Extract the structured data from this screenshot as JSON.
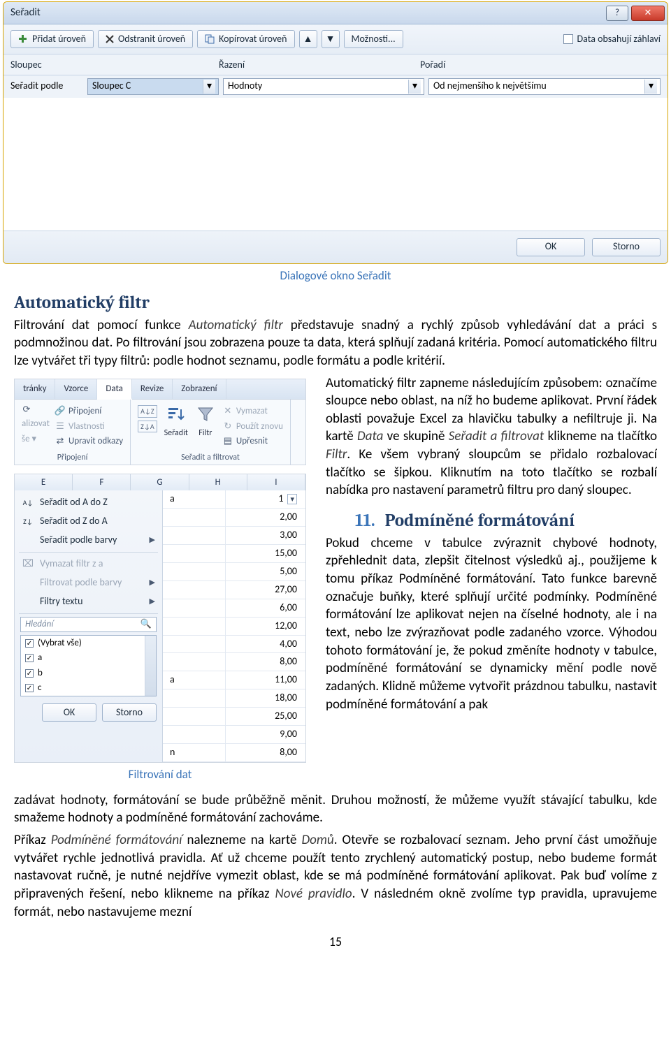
{
  "dialog": {
    "title": "Seřadit",
    "toolbar": {
      "add": "Přidat úroveň",
      "remove": "Odstranit úroveň",
      "copy": "Kopírovat úroveň",
      "options": "Možnosti...",
      "headers": "Data obsahují záhlaví"
    },
    "headers": {
      "col1": "Sloupec",
      "col2": "Řazení",
      "col3": "Pořadí"
    },
    "row": {
      "label": "Seřadit podle",
      "col": "Sloupec C",
      "by": "Hodnoty",
      "order": "Od nejmenšího k největšímu"
    },
    "ok": "OK",
    "cancel": "Storno"
  },
  "caption1": "Dialogové okno Seřadit",
  "sec_autofilter": {
    "title": "Automatický filtr",
    "p1a": "Filtrování dat pomocí funkce ",
    "p1i": "Automatický filtr",
    "p1b": " představuje snadný a rychlý způsob vyhledávání dat a práci s podmnožinou dat. Po filtrování jsou zobrazena pouze ta data, která splňují zadaná kritéria. Pomocí automatického filtru lze vytvářet tři typy filtrů: podle hodnot seznamu, podle formátu a podle kritérií.",
    "p2a": "Automatický filtr zapneme následujícím způsobem: označíme sloupce nebo oblast, na níž ho budeme aplikovat. První řádek oblasti považuje Excel za hlavičku tabulky a nefiltruje ji. Na kartě ",
    "p2i1": "Data",
    "p2b": " ve skupině ",
    "p2i2": "Seřadit a filtrovat",
    "p2c": " klikneme na tlačítko ",
    "p2i3": "Filtr",
    "p2d": ". Ke všem vybraný sloupcům se přidalo rozbalovací tlačítko se šipkou. Kliknutím na toto tlačítko se rozbalí nabídka pro nastavení parametrů filtru pro daný sloupec."
  },
  "ribbon": {
    "tabs": [
      "tránky",
      "Vzorce",
      "Data",
      "Revize",
      "Zobrazení"
    ],
    "grp1_items": [
      "Připojení",
      "Vlastnosti",
      "Upravit odkazy"
    ],
    "grp1_left": "alizovat",
    "grp1_left2": "še ▾",
    "grp1_title": "Připojení",
    "grp2_sort_az": "A→Z",
    "grp2_sort_za": "Z→A",
    "grp2_sort": "Seřadit",
    "grp2_filter": "Filtr",
    "grp2_items": [
      "Vymazat",
      "Použít znovu",
      "Upřesnit"
    ],
    "grp2_title": "Seřadit a filtrovat"
  },
  "sheet": {
    "cols": [
      "E",
      "F",
      "G",
      "H",
      "I"
    ],
    "menu": {
      "az": "Seřadit od A do Z",
      "za": "Seřadit od Z do A",
      "color": "Seřadit podle barvy",
      "clear": "Vymazat filtr z a",
      "bycolor": "Filtrovat podle barvy",
      "text": "Filtry textu",
      "search": "Hledání",
      "all": "(Vybrat vše)",
      "a": "a",
      "b": "b",
      "c": "c",
      "ok": "OK",
      "cancel": "Storno"
    },
    "rows": [
      {
        "l": "a",
        "r": "1"
      },
      {
        "l": "",
        "r": "2,00"
      },
      {
        "l": "",
        "r": "3,00"
      },
      {
        "l": "",
        "r": "15,00"
      },
      {
        "l": "",
        "r": "5,00"
      },
      {
        "l": "",
        "r": "27,00"
      },
      {
        "l": "",
        "r": "6,00"
      },
      {
        "l": "",
        "r": "12,00"
      },
      {
        "l": "",
        "r": "4,00"
      },
      {
        "l": "",
        "r": "8,00"
      },
      {
        "l": "a",
        "r": "11,00"
      },
      {
        "l": "",
        "r": "18,00"
      },
      {
        "l": "",
        "r": "25,00"
      },
      {
        "l": "",
        "r": "9,00"
      },
      {
        "l": "n",
        "r": "8,00"
      }
    ]
  },
  "caption2": "Filtrování dat",
  "sec11": {
    "num": "11.",
    "title": "Podmíněné formátování",
    "p1": "Pokud chceme v tabulce zvýraznit chybové hodnoty, zpřehlednit data, zlepšit čitelnost výsledků aj., použijeme k tomu příkaz Podmíněné formátování. Tato funkce barevně označuje buňky, které splňují určité podmínky. Podmíněné formátování lze aplikovat nejen na číselné hodnoty, ale i na text, nebo lze zvýrazňovat podle zadaného vzorce. Výhodou tohoto formátování je, že pokud změníte hodnoty v tabulce, podmíněné formátování se dynamicky mění podle nově zadaných. Klidně můžeme vytvořit prázdnou tabulku, nastavit podmíněné formátování a pak ",
    "p1b": "zadávat hodnoty, formátování se bude průběžně měnit. Druhou možností, že můžeme využít stávající tabulku, kde smažeme hodnoty a podmíněné formátování zachováme.",
    "p2a": "Příkaz ",
    "p2i1": "Podmíněné formátování",
    "p2b": " nalezneme na kartě ",
    "p2i2": "Domů",
    "p2c": ". Otevře se rozbalovací seznam. Jeho první část umožňuje vytvářet rychle jednotlivá pravidla. Ať už chceme použít tento zrychlený automatický postup, nebo budeme formát nastavovat ručně, je nutné nejdříve vymezit oblast, kde se má podmíněné formátování aplikovat. Pak buď volíme z připravených řešení, nebo klikneme na příkaz ",
    "p2i3": "Nové pravidlo",
    "p2d": ". V následném okně zvolíme typ pravidla, upravujeme formát, nebo nastavujeme mezní"
  },
  "pagenum": "15"
}
